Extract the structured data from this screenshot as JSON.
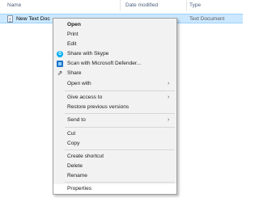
{
  "header": {
    "name_label": "Name",
    "date_label": "Date modified",
    "type_label": "Type"
  },
  "file": {
    "name": "New Text Document",
    "type": "Text Document",
    "icon": "text-file-icon"
  },
  "context_menu": {
    "open": "Open",
    "print": "Print",
    "edit": "Edit",
    "share_skype": "Share with Skype",
    "scan_defender": "Scan with Microsoft Defender...",
    "share": "Share",
    "open_with": "Open with",
    "give_access": "Give access to",
    "restore": "Restore previous versions",
    "send_to": "Send to",
    "cut": "Cut",
    "copy": "Copy",
    "create_shortcut": "Create shortcut",
    "delete": "Delete",
    "rename": "Rename",
    "properties": "Properties"
  },
  "colors": {
    "selection": "#cce8ff",
    "menu_bg": "#f2f2f2",
    "hover": "#ffffff",
    "skype": "#00aff0",
    "defender": "#1e73c8"
  }
}
